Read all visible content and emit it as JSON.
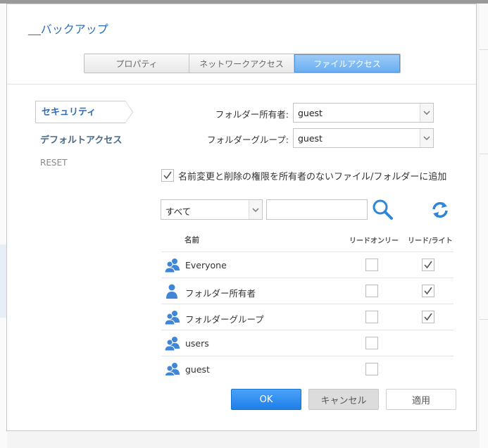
{
  "dialog": {
    "title": "__バックアップ",
    "tabs": [
      {
        "label": "プロパティ",
        "active": false
      },
      {
        "label": "ネットワークアクセス",
        "active": false
      },
      {
        "label": "ファイルアクセス",
        "active": true
      }
    ]
  },
  "sidebar": {
    "items": [
      {
        "label": "セキュリティ",
        "selected": true
      },
      {
        "label": "デフォルトアクセス",
        "selected": false
      },
      {
        "label": "RESET",
        "selected": false
      }
    ]
  },
  "form": {
    "owner_label": "フォルダー所有者:",
    "owner_value": "guest",
    "group_label": "フォルダーグループ:",
    "group_value": "guest",
    "checkbox_label": "名前変更と削除の権限を所有者のないファイル/フォルダーに追加",
    "checkbox_checked": true
  },
  "filter": {
    "select_value": "すべて",
    "search_value": "",
    "search_icon": "search-icon",
    "refresh_icon": "refresh-icon"
  },
  "table": {
    "columns": {
      "name": "名前",
      "read_only": "リードオンリー",
      "read_write": "リード/ライト"
    },
    "rows": [
      {
        "name": "Everyone",
        "icon": "group-icon",
        "read_only": false,
        "read_write": true
      },
      {
        "name": "フォルダー所有者",
        "icon": "user-icon",
        "read_only": false,
        "read_write": true
      },
      {
        "name": "フォルダーグループ",
        "icon": "group-icon",
        "read_only": false,
        "read_write": true
      },
      {
        "name": "users",
        "icon": "group-icon",
        "read_only": false,
        "read_write": null
      },
      {
        "name": "guest",
        "icon": "group-icon",
        "read_only": false,
        "read_write": null
      }
    ]
  },
  "buttons": {
    "ok": "OK",
    "cancel": "キャンセル",
    "apply": "適用"
  },
  "colors": {
    "accent": "#2a6ebb",
    "primary_button": "#2f8cf0",
    "icon_blue": "#3f86d8"
  }
}
